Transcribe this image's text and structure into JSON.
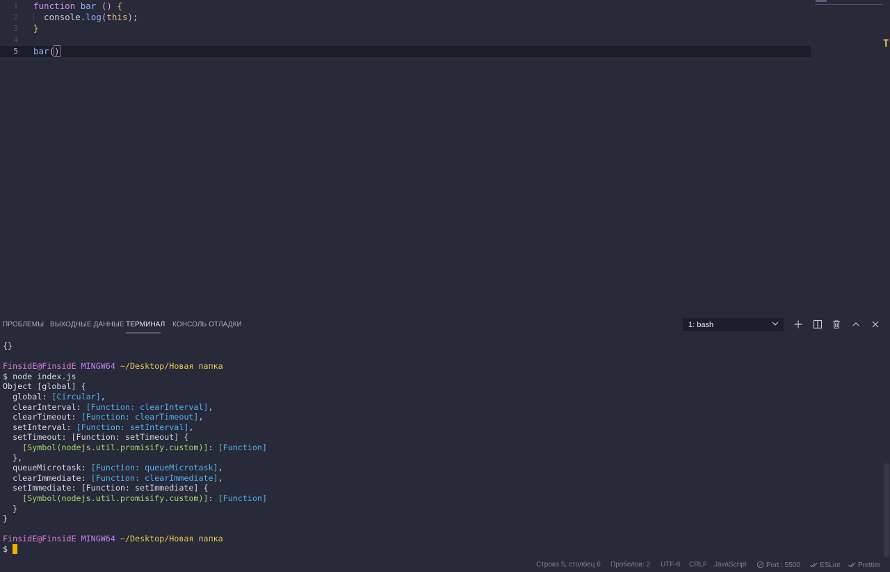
{
  "editor": {
    "lines": [
      {
        "number": "1",
        "tokens": [
          {
            "t": "function",
            "c": "kw"
          },
          {
            "t": " ",
            "c": "plain"
          },
          {
            "t": "bar",
            "c": "fn"
          },
          {
            "t": " ",
            "c": "plain"
          },
          {
            "t": "()",
            "c": "paren"
          },
          {
            "t": " ",
            "c": "plain"
          },
          {
            "t": "{",
            "c": "brace"
          }
        ]
      },
      {
        "number": "2",
        "tokens": [
          {
            "t": "  console.",
            "c": "plain"
          },
          {
            "t": "log",
            "c": "fn"
          },
          {
            "t": "(",
            "c": "paren"
          },
          {
            "t": "this",
            "c": "this"
          },
          {
            "t": ")",
            "c": "paren"
          },
          {
            "t": ";",
            "c": "plain"
          }
        ]
      },
      {
        "number": "3",
        "tokens": [
          {
            "t": "}",
            "c": "brace"
          }
        ]
      },
      {
        "number": "4",
        "tokens": []
      },
      {
        "number": "5",
        "tokens": [
          {
            "t": "bar",
            "c": "fn"
          },
          {
            "t": "(",
            "c": "paren"
          },
          {
            "t": ")",
            "c": "paren cursor-box"
          }
        ],
        "active": true
      }
    ],
    "ruler_mark": "T"
  },
  "panel": {
    "tabs": [
      {
        "label": "ПРОБЛЕМЫ",
        "active": false
      },
      {
        "label": "ВЫХОДНЫЕ ДАННЫЕ",
        "active": false
      },
      {
        "label": "ТЕРМИНАЛ",
        "active": true
      },
      {
        "label": "КОНСОЛЬ ОТЛАДКИ",
        "active": false
      }
    ],
    "terminal_selector": "1: bash",
    "icons": [
      "plus-icon",
      "split-icon",
      "trash-icon",
      "chevron-up-icon",
      "close-icon"
    ]
  },
  "terminal": {
    "lines": [
      [
        {
          "t": "{}",
          "c": ""
        }
      ],
      [],
      [
        {
          "t": "FinsidE@FinsidE",
          "c": "t-user"
        },
        {
          "t": " ",
          "c": ""
        },
        {
          "t": "MINGW64",
          "c": "t-host"
        },
        {
          "t": " ",
          "c": ""
        },
        {
          "t": "~/Desktop/Новая папка",
          "c": "t-path"
        }
      ],
      [
        {
          "t": "$ node index.js",
          "c": ""
        }
      ],
      [
        {
          "t": "Object [global] {",
          "c": ""
        }
      ],
      [
        {
          "t": "  global: ",
          "c": ""
        },
        {
          "t": "[Circular]",
          "c": "t-blue"
        },
        {
          "t": ",",
          "c": ""
        }
      ],
      [
        {
          "t": "  clearInterval: ",
          "c": ""
        },
        {
          "t": "[Function: clearInterval]",
          "c": "t-blue"
        },
        {
          "t": ",",
          "c": ""
        }
      ],
      [
        {
          "t": "  clearTimeout: ",
          "c": ""
        },
        {
          "t": "[Function: clearTimeout]",
          "c": "t-blue"
        },
        {
          "t": ",",
          "c": ""
        }
      ],
      [
        {
          "t": "  setInterval: ",
          "c": ""
        },
        {
          "t": "[Function: setInterval]",
          "c": "t-blue"
        },
        {
          "t": ",",
          "c": ""
        }
      ],
      [
        {
          "t": "  setTimeout: [Function: setTimeout] {",
          "c": ""
        }
      ],
      [
        {
          "t": "    ",
          "c": ""
        },
        {
          "t": "[Symbol(nodejs.util.promisify.custom)]",
          "c": "t-green"
        },
        {
          "t": ": ",
          "c": ""
        },
        {
          "t": "[Function]",
          "c": "t-blue"
        }
      ],
      [
        {
          "t": "  },",
          "c": ""
        }
      ],
      [
        {
          "t": "  queueMicrotask: ",
          "c": ""
        },
        {
          "t": "[Function: queueMicrotask]",
          "c": "t-blue"
        },
        {
          "t": ",",
          "c": ""
        }
      ],
      [
        {
          "t": "  clearImmediate: ",
          "c": ""
        },
        {
          "t": "[Function: clearImmediate]",
          "c": "t-blue"
        },
        {
          "t": ",",
          "c": ""
        }
      ],
      [
        {
          "t": "  setImmediate: [Function: setImmediate] {",
          "c": ""
        }
      ],
      [
        {
          "t": "    ",
          "c": ""
        },
        {
          "t": "[Symbol(nodejs.util.promisify.custom)]",
          "c": "t-green"
        },
        {
          "t": ": ",
          "c": ""
        },
        {
          "t": "[Function]",
          "c": "t-blue"
        }
      ],
      [
        {
          "t": "  }",
          "c": ""
        }
      ],
      [
        {
          "t": "}",
          "c": ""
        }
      ],
      [],
      [
        {
          "t": "FinsidE@FinsidE",
          "c": "t-user"
        },
        {
          "t": " ",
          "c": ""
        },
        {
          "t": "MINGW64",
          "c": "t-host"
        },
        {
          "t": " ",
          "c": ""
        },
        {
          "t": "~/Desktop/Новая папка",
          "c": "t-path"
        }
      ],
      [
        {
          "t": "$ ",
          "c": ""
        },
        {
          "t": "",
          "c": "t-cursor"
        }
      ]
    ]
  },
  "statusbar": {
    "position": "Строка 5, столбец 6",
    "spaces": "Пробелов: 2",
    "encoding": "UTF-8",
    "eol": "CRLF",
    "language": "JavaScript",
    "port": "Port : 5500",
    "eslint": "ESLint",
    "prettier": "Prettier"
  },
  "colors": {
    "background": "#282a3a",
    "active_line": "#1b1d29",
    "cursor": "#f0b400"
  }
}
